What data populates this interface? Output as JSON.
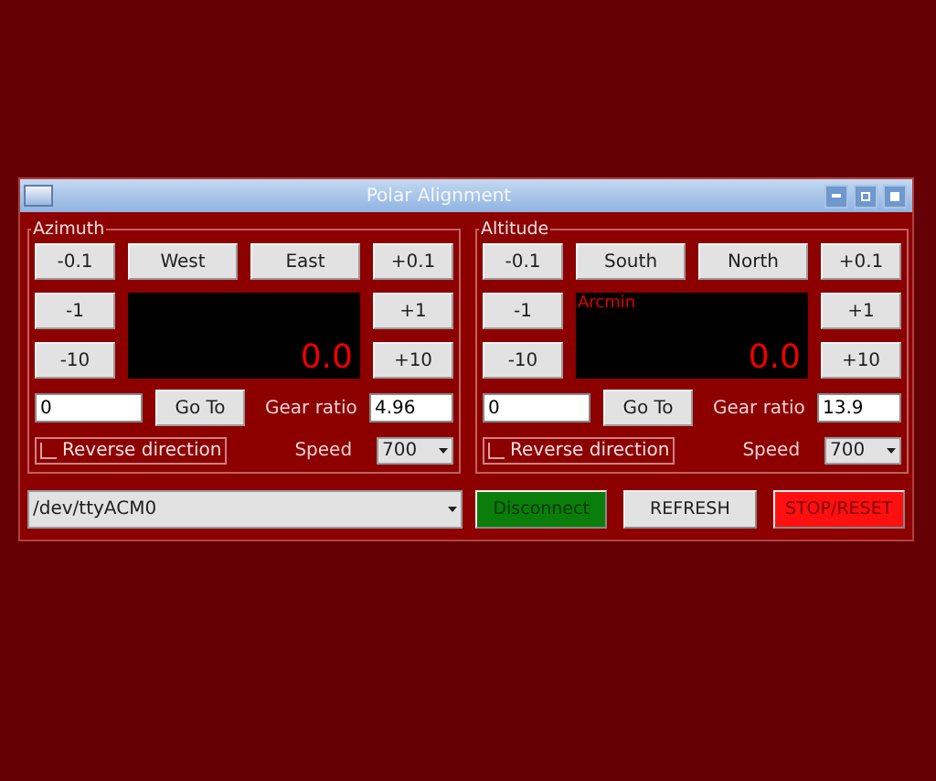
{
  "window": {
    "title": "Polar Alignment"
  },
  "panels": [
    {
      "title": "Azimuth",
      "minus_steps": [
        "-0.1",
        "-1",
        "-10"
      ],
      "plus_steps": [
        "+0.1",
        "+1",
        "+10"
      ],
      "directions": [
        "West",
        "East"
      ],
      "display": {
        "value": "0.0"
      },
      "goto": {
        "value": "0",
        "button": "Go To"
      },
      "gear": {
        "label": "Gear ratio",
        "value": "4.96"
      },
      "reverse": {
        "label": "Reverse direction",
        "checked": false
      },
      "speed": {
        "label": "Speed",
        "value": "700"
      }
    },
    {
      "title": "Altitude",
      "minus_steps": [
        "-0.1",
        "-1",
        "-10"
      ],
      "plus_steps": [
        "+0.1",
        "+1",
        "+10"
      ],
      "directions": [
        "South",
        "North"
      ],
      "display": {
        "unit": "Arcmin",
        "value": "0.0"
      },
      "goto": {
        "value": "0",
        "button": "Go To"
      },
      "gear": {
        "label": "Gear ratio",
        "value": "13.9"
      },
      "reverse": {
        "label": "Reverse direction",
        "checked": false
      },
      "speed": {
        "label": "Speed",
        "value": "700"
      }
    }
  ],
  "port": {
    "value": "/dev/ttyACM0"
  },
  "actions": [
    {
      "label": "Disconnect",
      "kind": "connect"
    },
    {
      "label": "REFRESH",
      "kind": "normal"
    },
    {
      "label": "STOP/RESET",
      "kind": "danger"
    }
  ]
}
